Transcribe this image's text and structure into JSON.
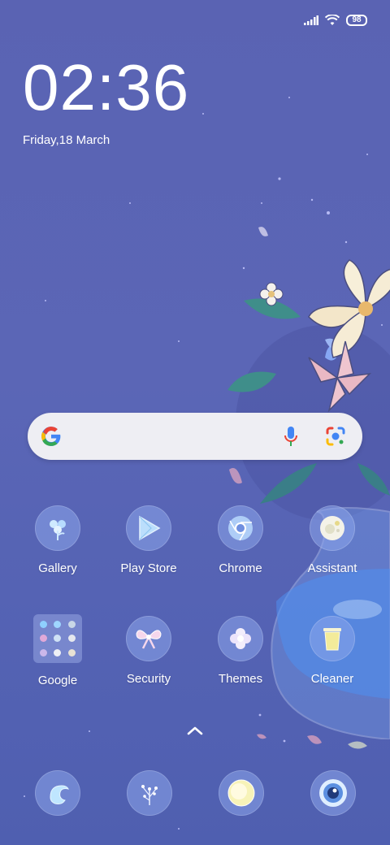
{
  "status_bar": {
    "signal": "signal-icon",
    "wifi": "wifi-icon",
    "battery_level": "98"
  },
  "clock": {
    "time": "02:36",
    "date": "Friday,18 March"
  },
  "search": {
    "logo": "google-g-icon",
    "voice": "mic-icon",
    "lens": "google-lens-icon"
  },
  "apps": [
    {
      "label": "Gallery",
      "icon": "gallery-icon"
    },
    {
      "label": "Play Store",
      "icon": "play-store-icon"
    },
    {
      "label": "Chrome",
      "icon": "chrome-icon"
    },
    {
      "label": "Assistant",
      "icon": "assistant-icon"
    },
    {
      "label": "Google",
      "icon": "google-folder-icon"
    },
    {
      "label": "Security",
      "icon": "security-icon"
    },
    {
      "label": "Themes",
      "icon": "themes-icon"
    },
    {
      "label": "Cleaner",
      "icon": "cleaner-icon"
    }
  ],
  "drawer": {
    "icon": "chevron-up-icon"
  },
  "dock": [
    {
      "icon": "phone-icon"
    },
    {
      "icon": "messages-icon"
    },
    {
      "icon": "browser-icon"
    },
    {
      "icon": "camera-icon"
    }
  ],
  "colors": {
    "background": "#5a63b3",
    "search_bar": "#eeeef3",
    "icon_bubble": "#8ca5eb",
    "text": "#ffffff"
  }
}
